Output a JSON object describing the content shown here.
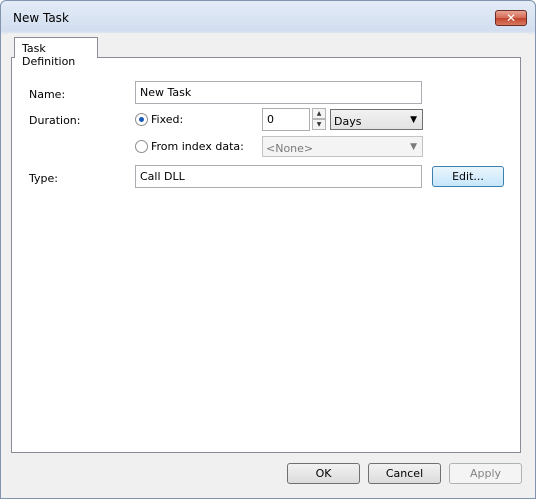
{
  "window": {
    "title": "New Task",
    "close_glyph": "✕"
  },
  "tabs": [
    {
      "label": "Task Definition"
    }
  ],
  "form": {
    "name": {
      "label": "Name:",
      "value": "New Task"
    },
    "duration": {
      "label": "Duration:",
      "fixed_label": "Fixed:",
      "fixed_value": "0",
      "unit": "Days",
      "from_index_label": "From index data:",
      "index_value": "<None>",
      "selected_option": "Fixed"
    },
    "type": {
      "label": "Type:",
      "value": "Call DLL",
      "edit_button": "Edit..."
    }
  },
  "buttons": {
    "ok": "OK",
    "cancel": "Cancel",
    "apply": "Apply"
  },
  "icons": {
    "dropdown": "chevron-down-icon",
    "spin_up": "arrow-up-icon",
    "spin_down": "arrow-down-icon"
  },
  "colors": {
    "accent": "#1b5bb6",
    "close": "#c1432e"
  }
}
